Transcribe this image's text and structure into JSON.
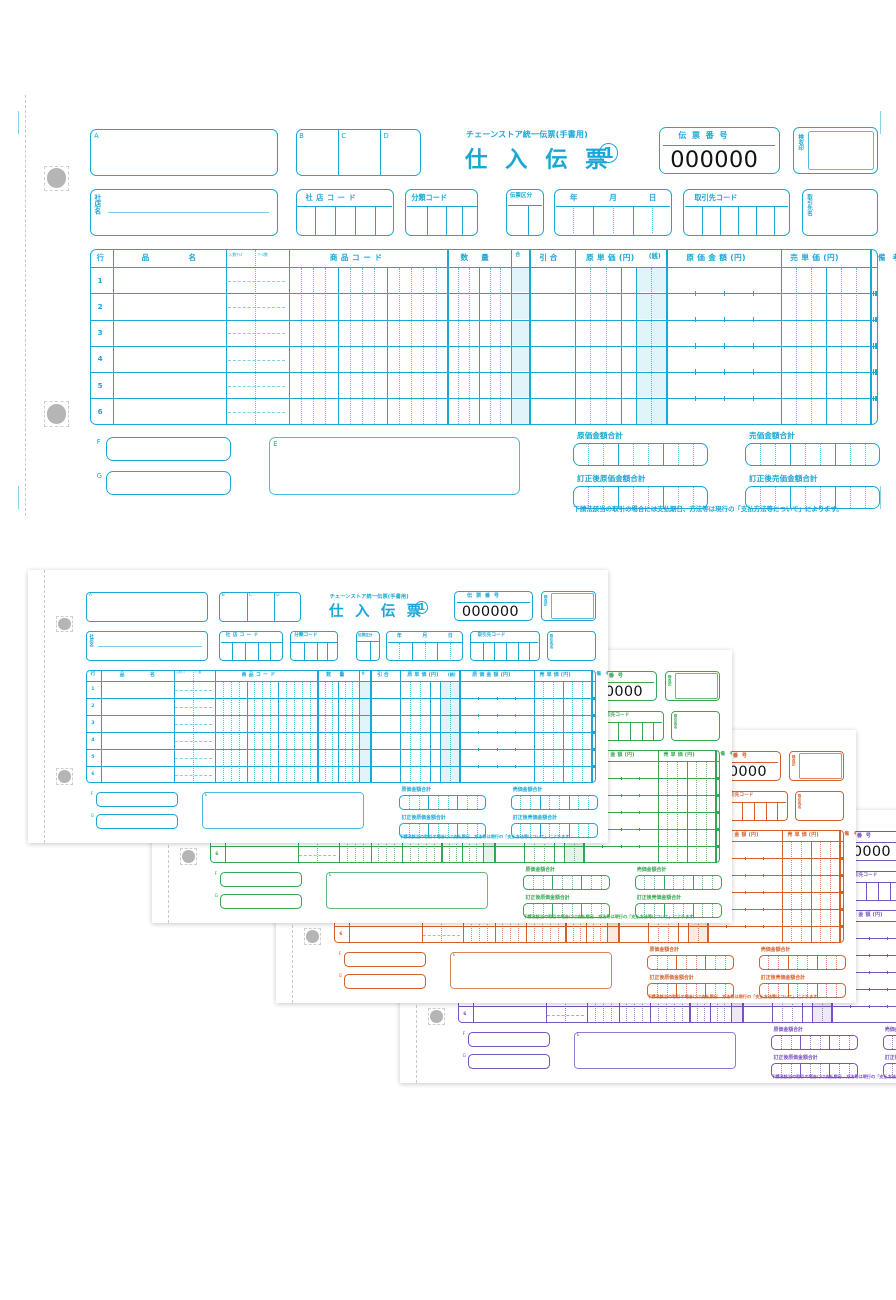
{
  "document": {
    "kind": "chain-store-unified-slip",
    "title_sub": "チェーンストア統一伝票(手書用)",
    "title_main": "仕 入 伝 票",
    "title_badge": "①",
    "slip_no_label": "伝 票 番 号",
    "slip_no_value": "000000",
    "inspection_stamp_label": "検収印",
    "footnote": "下請法該当の取引の場合には支払期日、方法等は現行の「支払方法等について」によります。"
  },
  "header_fields": {
    "a_label": "A",
    "b_label": "B",
    "c_label": "C",
    "d_label": "D",
    "store_name_label": "社店名",
    "store_code_label": "社 店 コ ー ド",
    "class_code_label": "分類コード",
    "slip_type_label": "伝票区分",
    "date_year": "年",
    "date_month": "月",
    "date_day": "日",
    "partner_code_label": "取引先コード",
    "partner_name_label": "取引先名"
  },
  "table": {
    "columns": [
      {
        "name": "row-no",
        "label": "行"
      },
      {
        "name": "item-name",
        "label": "品　　　　名"
      },
      {
        "name": "case-size",
        "label": "入数/ケース"
      },
      {
        "name": "product-code",
        "label": "商 品 コ ー ド"
      },
      {
        "name": "quantity",
        "label": "数　量"
      },
      {
        "name": "unit-mark",
        "label": "合"
      },
      {
        "name": "discount",
        "label": "引 合"
      },
      {
        "name": "cost-unit",
        "label": "原 単 価 (円)"
      },
      {
        "name": "cost-unit-sub",
        "label": "(銭)"
      },
      {
        "name": "cost-amount",
        "label": "原 価 金 額 (円)"
      },
      {
        "name": "price-unit",
        "label": "売 単 価 (円)"
      },
      {
        "name": "remarks",
        "label": "備　考 (売価金額)"
      }
    ],
    "case_size_sub": [
      "入数ｻｲｽﾞ",
      "ｹｰｽ数"
    ],
    "rows": [
      "1",
      "2",
      "3",
      "4",
      "5",
      "6"
    ]
  },
  "totals": {
    "cost_total_label": "原価金額合計",
    "price_total_label": "売価金額合計",
    "cost_total_corrected_label": "訂正後原価金額合計",
    "price_total_corrected_label": "訂正後売価金額合計"
  },
  "bottom_fields": {
    "f_label": "F",
    "g_label": "G",
    "e_label": "E"
  },
  "colors": {
    "copy_1_blue": "#1BA7D6",
    "copy_2_green": "#35A853",
    "copy_3_orange": "#D4602A",
    "copy_4_purple": "#7A52C4",
    "punch_hole": "#b5b5b5",
    "perforation": "#c9c9c9",
    "slip_number_text": "#111111"
  },
  "stack": {
    "copies": [
      {
        "name": "copy-1",
        "color_key": "copy_1_blue"
      },
      {
        "name": "copy-2",
        "color_key": "copy_2_green"
      },
      {
        "name": "copy-3",
        "color_key": "copy_3_orange"
      },
      {
        "name": "copy-4",
        "color_key": "copy_4_purple"
      }
    ]
  }
}
